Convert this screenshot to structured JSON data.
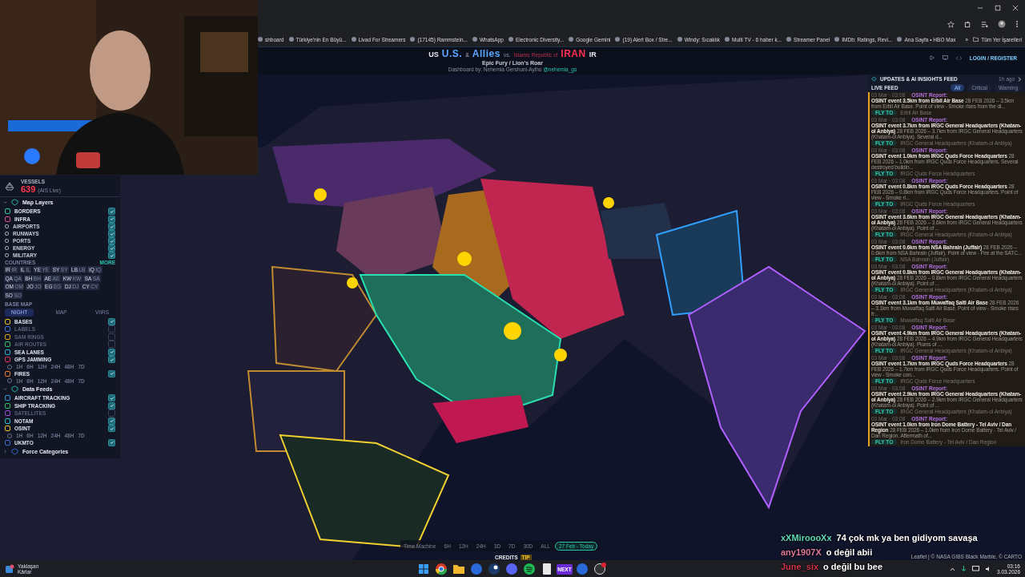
{
  "bookmarks": [
    {
      "label": "shboard"
    },
    {
      "label": "Türkiye'nin En Büyü..."
    },
    {
      "label": "Livad For Streamers"
    },
    {
      "label": "(17145) Rammstein..."
    },
    {
      "label": "WhatsApp"
    },
    {
      "label": "Electronic Diversity..."
    },
    {
      "label": "Google Gemini"
    },
    {
      "label": "(19) Alert Box / Stre..."
    },
    {
      "label": "Windy: Sıcaklık"
    },
    {
      "label": "Multi TV - 6 haber k..."
    },
    {
      "label": "Streamer Panel"
    },
    {
      "label": "IMDb: Ratings, Revi..."
    },
    {
      "label": "Ana Sayfa • HBO Max"
    }
  ],
  "bookmarks_more": "»",
  "all_bookmarks": "Tüm Yer İşaretleri",
  "header": {
    "title": [
      {
        "kind": "flag",
        "text": "US"
      },
      {
        "kind": "ally",
        "text": "U.S."
      },
      {
        "kind": "small",
        "text": "&"
      },
      {
        "kind": "ally",
        "text": "Allies"
      },
      {
        "kind": "vs",
        "text": "vs."
      },
      {
        "kind": "tiny",
        "text": "Islamic Republic of"
      },
      {
        "kind": "enemy",
        "text": "IRAN"
      },
      {
        "kind": "flag",
        "text": "IR"
      }
    ],
    "subtitle": "Epic Fury / Lion's Roar",
    "byline": "Dashboard by: Nehemia Gershuni-Aylho",
    "handle": "@nehemia_gs",
    "login": "LOGIN / REGISTER"
  },
  "left_panel": {
    "vessels": {
      "label": "VESSELS",
      "count": "639",
      "note": "(AIS Live)"
    },
    "sections": [
      {
        "title": "Map Layers",
        "expanded": true,
        "items": [
          {
            "kind": "layer",
            "label": "BORDERS",
            "checked": true,
            "color": "#2bc4b0"
          },
          {
            "kind": "layer",
            "label": "INFRA",
            "checked": true,
            "color": "#e0508a"
          },
          {
            "kind": "sublayer",
            "label": "AIRPORTS",
            "checked": true,
            "color": "#9aa3b8"
          },
          {
            "kind": "sublayer",
            "label": "RUNWAYS",
            "checked": true,
            "color": "#9aa3b8"
          },
          {
            "kind": "sublayer",
            "label": "PORTS",
            "checked": true,
            "color": "#9aa3b8"
          },
          {
            "kind": "sublayer",
            "label": "ENERGY",
            "checked": true,
            "color": "#9aa3b8"
          },
          {
            "kind": "sublayer",
            "label": "MILITARY",
            "checked": true,
            "color": "#9aa3b8"
          },
          {
            "kind": "countries",
            "label": "COUNTRIES",
            "more": "MORE",
            "chips": [
              {
                "code": "IR",
                "flag": "IR"
              },
              {
                "code": "IL",
                "flag": "IL"
              },
              {
                "code": "YE",
                "flag": "YE"
              },
              {
                "code": "SY",
                "flag": "SY"
              },
              {
                "code": "LB",
                "flag": "LB"
              },
              {
                "code": "IQ",
                "flag": "IQ"
              },
              {
                "code": "QA",
                "flag": "QA"
              },
              {
                "code": "BH",
                "flag": "BH"
              },
              {
                "code": "AE",
                "flag": "AE"
              },
              {
                "code": "KW",
                "flag": "KW"
              },
              {
                "code": "SA",
                "flag": "SA"
              },
              {
                "code": "OM",
                "flag": "OM"
              },
              {
                "code": "JO",
                "flag": "JO"
              },
              {
                "code": "EG",
                "flag": "EG"
              },
              {
                "code": "DJ",
                "flag": "DJ"
              },
              {
                "code": "CY",
                "flag": "CY"
              },
              {
                "code": "SO",
                "flag": "SO"
              }
            ]
          },
          {
            "kind": "basemap",
            "label": "BASE MAP",
            "options": [
              {
                "label": "NIGHT",
                "selected": true
              },
              {
                "label": "MAP",
                "selected": false
              },
              {
                "label": "VIIRS",
                "selected": false
              }
            ]
          },
          {
            "kind": "layer",
            "label": "BASES",
            "checked": true,
            "color": "#e8c22a"
          },
          {
            "kind": "layer",
            "label": "LABELS",
            "checked": false,
            "color": "#3a6fd8"
          },
          {
            "kind": "layer",
            "label": "SAM RINGS",
            "checked": false,
            "color": "#d8a21a"
          },
          {
            "kind": "layer",
            "label": "AIR ROUTES",
            "checked": false,
            "color": "#2ec46a"
          },
          {
            "kind": "layer",
            "label": "SEA LANES",
            "checked": true,
            "color": "#2bb4d0"
          },
          {
            "kind": "layer",
            "label": "GPS JAMMING",
            "checked": true,
            "color": "#e0305a"
          },
          {
            "kind": "time",
            "labels": [
              "1H",
              "6H",
              "12H",
              "24H",
              "48H",
              "7D"
            ]
          },
          {
            "kind": "layer",
            "label": "FIRES",
            "checked": true,
            "color": "#f08030"
          },
          {
            "kind": "time",
            "labels": [
              "1H",
              "6H",
              "12H",
              "24H",
              "48H",
              "7D"
            ]
          }
        ]
      },
      {
        "title": "Data Feeds",
        "expanded": true,
        "items": [
          {
            "kind": "layer",
            "label": "AIRCRAFT TRACKING",
            "checked": true,
            "color": "#2b9ad8"
          },
          {
            "kind": "layer",
            "label": "SHIP TRACKING",
            "checked": true,
            "color": "#2ec46a"
          },
          {
            "kind": "layer",
            "label": "SATELLITES",
            "checked": false,
            "color": "#9a4ad8"
          },
          {
            "kind": "layer",
            "label": "NOTAM",
            "checked": true,
            "color": "#2bc4d0"
          },
          {
            "kind": "layer",
            "label": "OSINT",
            "checked": true,
            "color": "#e8c22a"
          },
          {
            "kind": "time",
            "labels": [
              "1H",
              "6H",
              "12H",
              "24H",
              "48H",
              "7D"
            ]
          },
          {
            "kind": "layer",
            "label": "UKMTO",
            "checked": true,
            "color": "#3a6fd8"
          }
        ]
      },
      {
        "title": "Force Categories",
        "expanded": false
      }
    ]
  },
  "feed": {
    "title": "UPDATES & AI INSIGHTS FEED",
    "updated": "1h ago",
    "live": "LIVE FEED",
    "filters": [
      {
        "label": "All",
        "selected": true
      },
      {
        "label": "Critical",
        "selected": false
      },
      {
        "label": "Warning",
        "selected": false
      }
    ],
    "items": [
      {
        "time": "03 Mar · 03:08",
        "tag": "OSINT Report:",
        "title": "OSINT event 3.5km from Erbil Air Base",
        "text": "28 FEB 2026 – 3.5km from Erbil Air Base. Point of view - Smoke rises from the di...",
        "action": "FLY TO",
        "location": "Erbil Air Base"
      },
      {
        "time": "03 Mar · 03:08",
        "tag": "OSINT Report:",
        "title": "OSINT event 3.7km from IRGC General Headquarters (Khatam-ol Anbiya)",
        "text": "28 FEB 2026 – 3.7km from IRGC General Headquarters (Khatam-ol Anbiya). Several d...",
        "action": "FLY TO",
        "location": "IRGC General Headquarters (Khatam-ol Anbiya)"
      },
      {
        "time": "03 Mar · 03:08",
        "tag": "OSINT Report:",
        "title": "OSINT event 1.0km from IRGC Quds Force Headquarters",
        "text": "28 FEB 2026 – 1.0km from IRGC Quds Force Headquarters. Several destroyed buildin...",
        "action": "FLY TO",
        "location": "IRGC Quds Force Headquarters"
      },
      {
        "time": "03 Mar · 03:08",
        "tag": "OSINT Report:",
        "title": "OSINT event 0.8km from IRGC Quds Force Headquarters",
        "text": "28 FEB 2026 – 0.8km from IRGC Quds Force Headquarters. Point of view - Smoke ri...",
        "action": "FLY TO",
        "location": "IRGC Quds Force Headquarters"
      },
      {
        "time": "03 Mar · 03:08",
        "tag": "OSINT Report:",
        "title": "OSINT event 3.6km from IRGC General Headquarters (Khatam-ol Anbiya)",
        "text": "28 FEB 2026 – 3.6km from IRGC General Headquarters (Khatam-ol Anbiya). Point of ...",
        "action": "FLY TO",
        "location": "IRGC General Headquarters (Khatam-ol Anbiya)"
      },
      {
        "time": "03 Mar · 03:08",
        "tag": "OSINT Report:",
        "title": "OSINT event 0.6km from NSA Bahrain (Juffair)",
        "text": "28 FEB 2026 – 0.6km from NSA Bahrain (Juffair). Point of view - Fire at the SATC...",
        "action": "FLY TO",
        "location": "NSA Bahrain (Juffair)"
      },
      {
        "time": "03 Mar · 03:08",
        "tag": "OSINT Report:",
        "title": "OSINT event 0.8km from IRGC General Headquarters (Khatam-ol Anbiya)",
        "text": "28 FEB 2026 – 0.8km from IRGC General Headquarters (Khatam-ol Anbiya). Point of ...",
        "action": "FLY TO",
        "location": "IRGC General Headquarters (Khatam-ol Anbiya)"
      },
      {
        "time": "03 Mar · 03:08",
        "tag": "OSINT Report:",
        "title": "OSINT event 3.1km from Muwaffaq Salti Air Base",
        "text": "28 FEB 2026 – 3.1km from Muwaffaq Salti Air Base. Point of view - Smoke rises fr...",
        "action": "FLY TO",
        "location": "Muwaffaq Salti Air Base"
      },
      {
        "time": "03 Mar · 03:08",
        "tag": "OSINT Report:",
        "title": "OSINT event 4.9km from IRGC General Headquarters (Khatam-ol Anbiya)",
        "text": "28 FEB 2026 – 4.9km from IRGC General Headquarters (Khatam-ol Anbiya). Plums of ...",
        "action": "FLY TO",
        "location": "IRGC General Headquarters (Khatam-ol Anbiya)"
      },
      {
        "time": "03 Mar · 03:08",
        "tag": "OSINT Report:",
        "title": "OSINT event 1.7km from IRGC Quds Force Headquarters",
        "text": "28 FEB 2026 – 1.7km from IRGC Quds Force Headquarters. Point of view - Smoke con...",
        "action": "FLY TO",
        "location": "IRGC Quds Force Headquarters"
      },
      {
        "time": "03 Mar · 03:08",
        "tag": "OSINT Report:",
        "title": "OSINT event 2.9km from IRGC General Headquarters (Khatam-ol Anbiya)",
        "text": "28 FEB 2026 – 2.9km from IRGC General Headquarters (Khatam-ol Anbiya). Point of ...",
        "action": "FLY TO",
        "location": "IRGC General Headquarters (Khatam-ol Anbiya)"
      },
      {
        "time": "03 Mar · 03:08",
        "tag": "OSINT Report:",
        "title": "OSINT event 1.0km from Iron Dome Battery - Tel Aviv / Dan Region",
        "text": "28 FEB 2026 – 1.0km from Iron Dome Battery - Tel Aviv / Dan Region. Aftermath of...",
        "action": "FLY TO",
        "location": "Iron Dome Battery - Tel Aviv / Dan Region"
      }
    ]
  },
  "time_machine": {
    "label": "Time Machine",
    "ranges": [
      {
        "label": "6H",
        "selected": false
      },
      {
        "label": "12H",
        "selected": false
      },
      {
        "label": "24H",
        "selected": false
      },
      {
        "label": "3D",
        "selected": false
      },
      {
        "label": "7D",
        "selected": false
      },
      {
        "label": "30D",
        "selected": false
      },
      {
        "label": "ALL",
        "selected": false
      },
      {
        "label": "27 Feb - Today",
        "selected": true
      }
    ]
  },
  "credits": "CREDITS",
  "tip": "TIP",
  "attribution": "Leaflet | © NASA GIBS Black Marble, © CARTO",
  "chat": [
    {
      "user": "xXMiroooXx",
      "color": "#5fd9b4",
      "message": "74 çok mk ya ben gidiyom savaşa"
    },
    {
      "user": "any1907X",
      "color": "#e07a9a",
      "message": "o değil abii"
    },
    {
      "user": "June_six",
      "color": "#d0354a",
      "message": "o değil bu bee"
    }
  ],
  "taskbar": {
    "weather_title": "Yaklaşan",
    "weather_subtitle": "Kârlar",
    "app_label": "NEXT",
    "time": "03:16",
    "date": "3.03.2026"
  }
}
